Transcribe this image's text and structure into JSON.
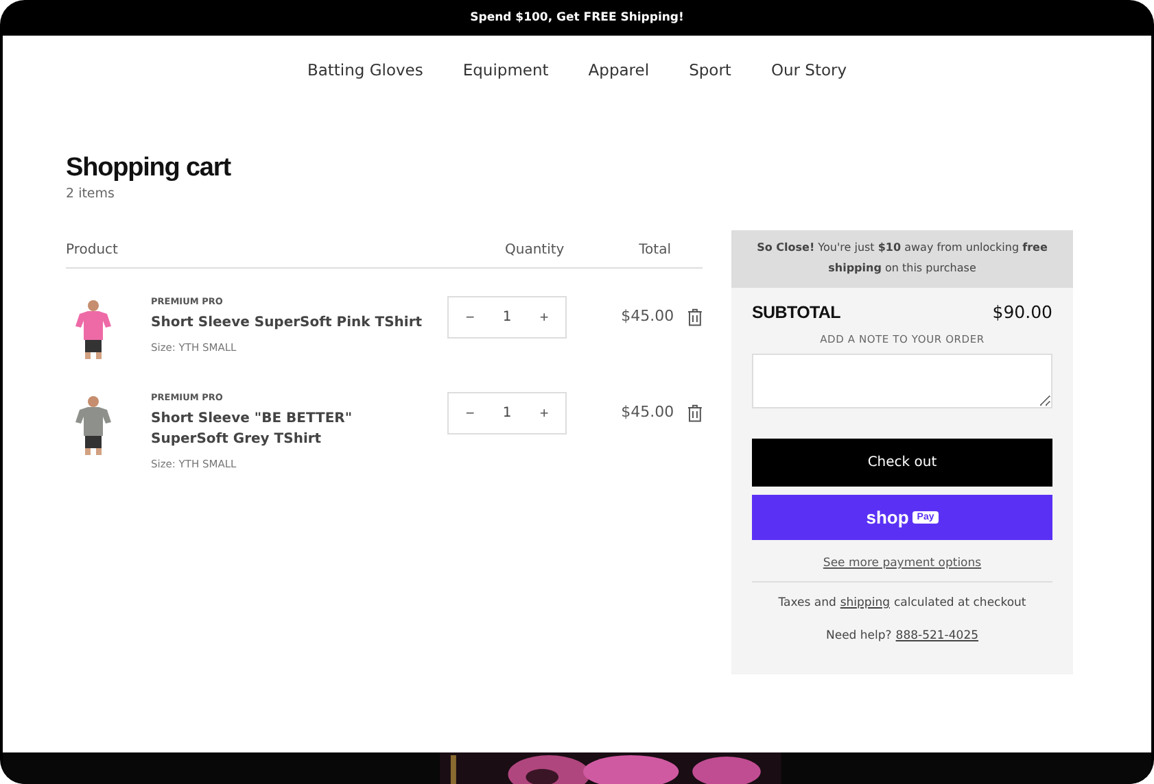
{
  "announcement": "Spend $100, Get FREE Shipping!",
  "nav": [
    "Batting Gloves",
    "Equipment",
    "Apparel",
    "Sport",
    "Our Story"
  ],
  "cart": {
    "title": "Shopping cart",
    "count": "2 items",
    "columns": [
      "Product",
      "Quantity",
      "Total"
    ],
    "items": [
      {
        "vendor": "PREMIUM PRO",
        "name": "Short Sleeve SuperSoft Pink TShirt",
        "variant": "Size: YTH SMALL",
        "quantity": "1",
        "total": "$45.00"
      },
      {
        "vendor": "PREMIUM PRO",
        "name": "Short Sleeve \"BE BETTER\" SuperSoft Grey TShirt",
        "variant": "Size: YTH SMALL",
        "quantity": "1",
        "total": "$45.00"
      }
    ],
    "decrement": "−",
    "increment": "+"
  },
  "summary": {
    "shipping_notice": "**So Close!** You're just **$10** away from unlocking **free shipping** on this purchase",
    "subtotal_label": "SUBTOTAL",
    "subtotal": "$90.00",
    "note_label": "ADD A NOTE TO YOUR ORDER",
    "checkout": "Check out",
    "shop_pay": {
      "word": "shop",
      "badge": "Pay"
    },
    "more_options": "See more payment options",
    "taxes": {
      "before": "Taxes and",
      "link": "shipping",
      "after": "calculated at checkout"
    },
    "help": {
      "before": "Need help?",
      "link": "888-521-4025"
    }
  }
}
